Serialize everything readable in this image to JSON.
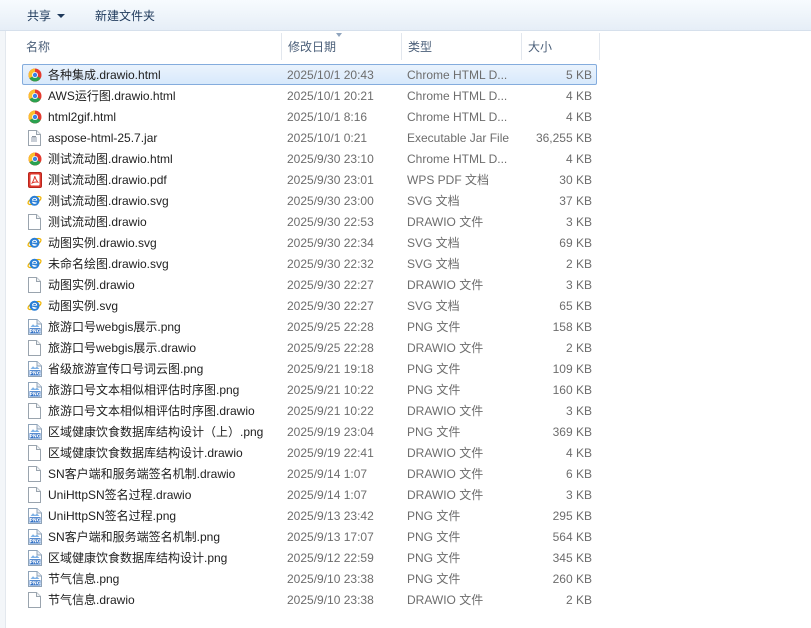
{
  "toolbar": {
    "share_label": "共享",
    "new_folder_label": "新建文件夹"
  },
  "columns": {
    "name": "名称",
    "date": "修改日期",
    "type": "类型",
    "size": "大小"
  },
  "colors": {
    "selection_border": "#84acdd",
    "selection_fill": "#d8e9fb",
    "header_text": "#4c607a",
    "meta_text": "#6d6d6d"
  },
  "files": [
    {
      "icon": "chrome-icon",
      "name": "各种集成.drawio.html",
      "date": "2025/10/1 20:43",
      "type": "Chrome HTML D...",
      "size": "5 KB",
      "selected": true
    },
    {
      "icon": "chrome-icon",
      "name": "AWS运行图.drawio.html",
      "date": "2025/10/1 20:21",
      "type": "Chrome HTML D...",
      "size": "4 KB"
    },
    {
      "icon": "chrome-icon",
      "name": "html2gif.html",
      "date": "2025/10/1 8:16",
      "type": "Chrome HTML D...",
      "size": "4 KB"
    },
    {
      "icon": "jar-icon",
      "name": "aspose-html-25.7.jar",
      "date": "2025/10/1 0:21",
      "type": "Executable Jar File",
      "size": "36,255 KB"
    },
    {
      "icon": "chrome-icon",
      "name": "测试流动图.drawio.html",
      "date": "2025/9/30 23:10",
      "type": "Chrome HTML D...",
      "size": "4 KB"
    },
    {
      "icon": "pdf-icon",
      "name": "测试流动图.drawio.pdf",
      "date": "2025/9/30 23:01",
      "type": "WPS PDF 文档",
      "size": "30 KB"
    },
    {
      "icon": "ie-icon",
      "name": "测试流动图.drawio.svg",
      "date": "2025/9/30 23:00",
      "type": "SVG 文档",
      "size": "37 KB"
    },
    {
      "icon": "blank-file-icon",
      "name": "测试流动图.drawio",
      "date": "2025/9/30 22:53",
      "type": "DRAWIO 文件",
      "size": "3 KB"
    },
    {
      "icon": "ie-icon",
      "name": "动图实例.drawio.svg",
      "date": "2025/9/30 22:34",
      "type": "SVG 文档",
      "size": "69 KB"
    },
    {
      "icon": "ie-icon",
      "name": "未命名绘图.drawio.svg",
      "date": "2025/9/30 22:32",
      "type": "SVG 文档",
      "size": "2 KB"
    },
    {
      "icon": "blank-file-icon",
      "name": "动图实例.drawio",
      "date": "2025/9/30 22:27",
      "type": "DRAWIO 文件",
      "size": "3 KB"
    },
    {
      "icon": "ie-icon",
      "name": "动图实例.svg",
      "date": "2025/9/30 22:27",
      "type": "SVG 文档",
      "size": "65 KB"
    },
    {
      "icon": "png-icon",
      "name": "旅游口号webgis展示.png",
      "date": "2025/9/25 22:28",
      "type": "PNG 文件",
      "size": "158 KB"
    },
    {
      "icon": "blank-file-icon",
      "name": "旅游口号webgis展示.drawio",
      "date": "2025/9/25 22:28",
      "type": "DRAWIO 文件",
      "size": "2 KB"
    },
    {
      "icon": "png-icon",
      "name": "省级旅游宣传口号词云图.png",
      "date": "2025/9/21 19:18",
      "type": "PNG 文件",
      "size": "109 KB"
    },
    {
      "icon": "png-icon",
      "name": "旅游口号文本相似相评估时序图.png",
      "date": "2025/9/21 10:22",
      "type": "PNG 文件",
      "size": "160 KB"
    },
    {
      "icon": "blank-file-icon",
      "name": "旅游口号文本相似相评估时序图.drawio",
      "date": "2025/9/21 10:22",
      "type": "DRAWIO 文件",
      "size": "3 KB"
    },
    {
      "icon": "png-icon",
      "name": "区域健康饮食数据库结构设计（上）.png",
      "date": "2025/9/19 23:04",
      "type": "PNG 文件",
      "size": "369 KB"
    },
    {
      "icon": "blank-file-icon",
      "name": "区域健康饮食数据库结构设计.drawio",
      "date": "2025/9/19 22:41",
      "type": "DRAWIO 文件",
      "size": "4 KB"
    },
    {
      "icon": "blank-file-icon",
      "name": "SN客户端和服务端签名机制.drawio",
      "date": "2025/9/14 1:07",
      "type": "DRAWIO 文件",
      "size": "6 KB"
    },
    {
      "icon": "blank-file-icon",
      "name": "UniHttpSN签名过程.drawio",
      "date": "2025/9/14 1:07",
      "type": "DRAWIO 文件",
      "size": "3 KB"
    },
    {
      "icon": "png-icon",
      "name": "UniHttpSN签名过程.png",
      "date": "2025/9/13 23:42",
      "type": "PNG 文件",
      "size": "295 KB"
    },
    {
      "icon": "png-icon",
      "name": "SN客户端和服务端签名机制.png",
      "date": "2025/9/13 17:07",
      "type": "PNG 文件",
      "size": "564 KB"
    },
    {
      "icon": "png-icon",
      "name": "区域健康饮食数据库结构设计.png",
      "date": "2025/9/12 22:59",
      "type": "PNG 文件",
      "size": "345 KB"
    },
    {
      "icon": "png-icon",
      "name": "节气信息.png",
      "date": "2025/9/10 23:38",
      "type": "PNG 文件",
      "size": "260 KB"
    },
    {
      "icon": "blank-file-icon",
      "name": "节气信息.drawio",
      "date": "2025/9/10 23:38",
      "type": "DRAWIO 文件",
      "size": "2 KB"
    }
  ]
}
